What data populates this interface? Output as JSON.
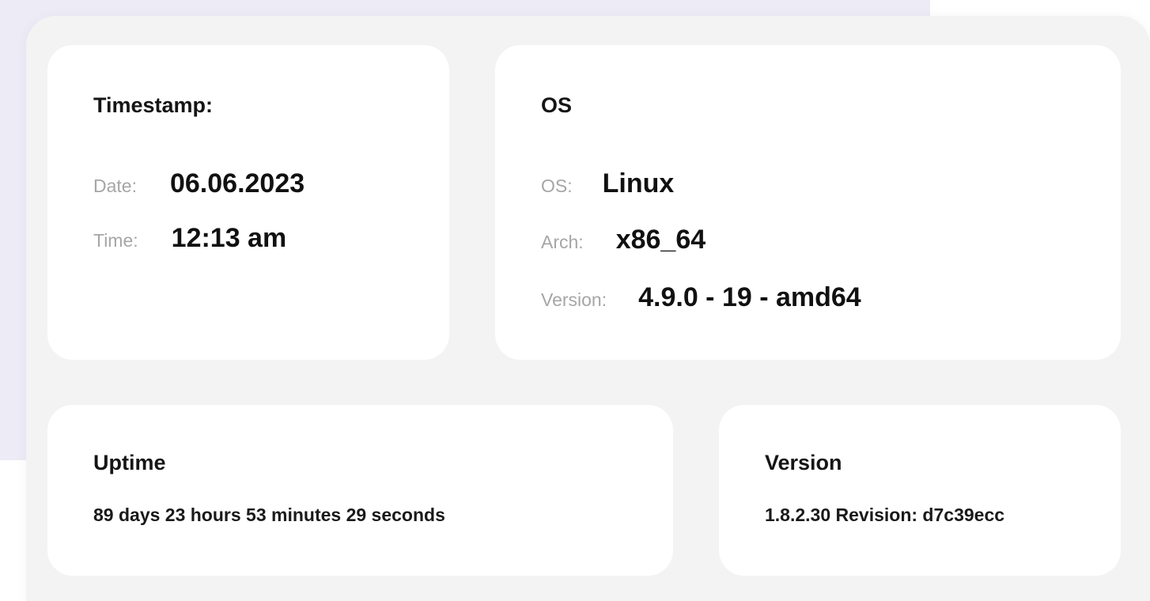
{
  "timestamp_card": {
    "title": "Timestamp:",
    "date_label": "Date:",
    "date_value": "06.06.2023",
    "time_label": "Time:",
    "time_value": "12:13 am"
  },
  "os_card": {
    "title": "OS",
    "os_label": "OS:",
    "os_value": "Linux",
    "arch_label": "Arch:",
    "arch_value": "x86_64",
    "version_label": "Version:",
    "version_value": "4.9.0 - 19 - amd64"
  },
  "uptime_card": {
    "title": "Uptime",
    "value": "89 days 23 hours 53 minutes 29 seconds"
  },
  "version_card": {
    "title": "Version",
    "value": "1.8.2.30 Revision: d7c39ecc"
  },
  "colors": {
    "backdrop": "#ecebf6",
    "panel": "#f3f3f3",
    "card": "#ffffff",
    "label": "#a6a6a6",
    "value": "#111111"
  }
}
